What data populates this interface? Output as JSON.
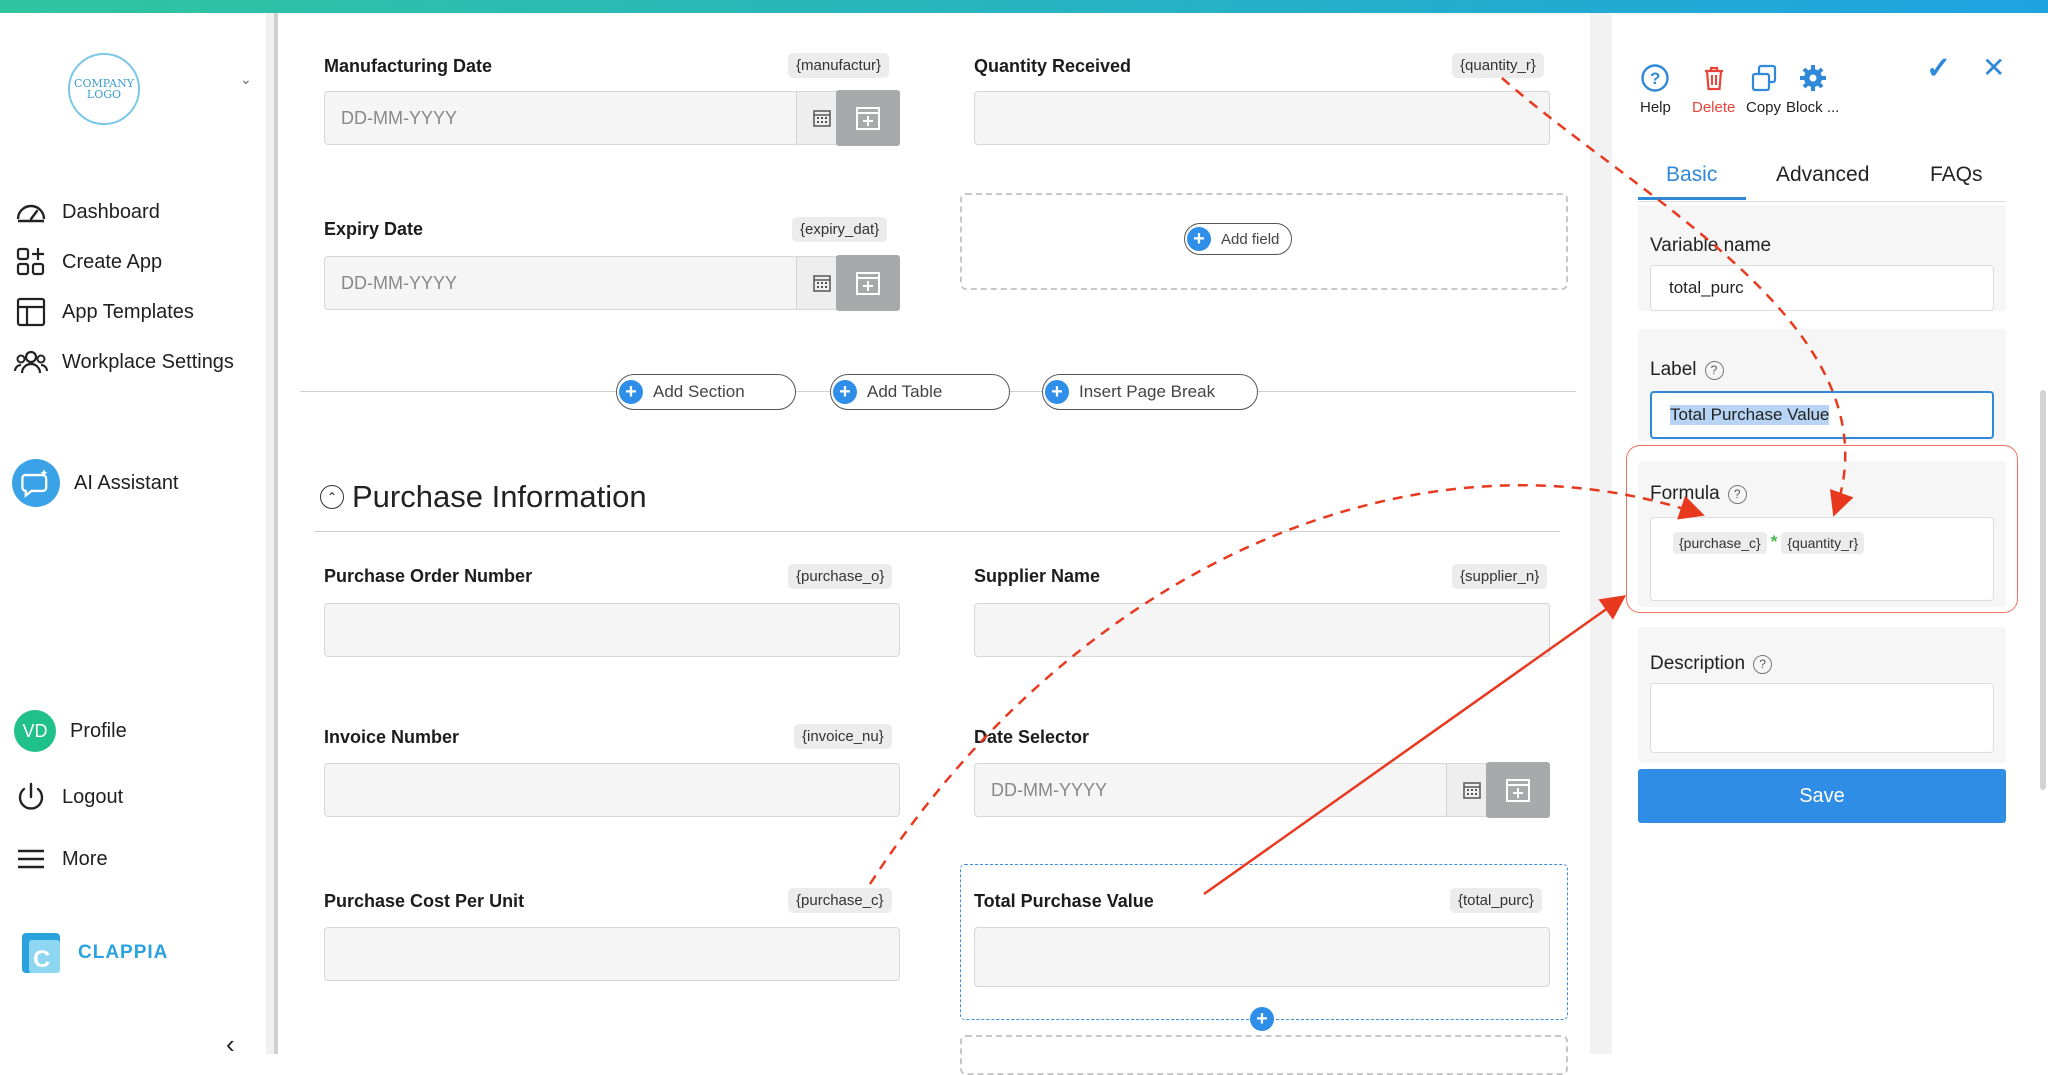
{
  "sidebar": {
    "logo_text": "COMPANY LOGO",
    "nav": [
      {
        "label": "Dashboard"
      },
      {
        "label": "Create App"
      },
      {
        "label": "App Templates"
      },
      {
        "label": "Workplace Settings"
      },
      {
        "label": "AI Assistant"
      }
    ],
    "profile": {
      "initials": "VD",
      "label": "Profile"
    },
    "logout_label": "Logout",
    "more_label": "More",
    "brand": "CLAPPIA"
  },
  "form": {
    "manufacturing": {
      "label": "Manufacturing Date",
      "var": "{manufactur}",
      "placeholder": "DD-MM-YYYY"
    },
    "quantity": {
      "label": "Quantity Received",
      "var": "{quantity_r}"
    },
    "expiry": {
      "label": "Expiry Date",
      "var": "{expiry_dat}",
      "placeholder": "DD-MM-YYYY"
    },
    "add_field_label": "Add field",
    "actions": {
      "add_section": "Add Section",
      "add_table": "Add Table",
      "insert_page_break": "Insert Page Break"
    },
    "section_title": "Purchase Information",
    "po_number": {
      "label": "Purchase Order Number",
      "var": "{purchase_o}"
    },
    "supplier": {
      "label": "Supplier Name",
      "var": "{supplier_n}"
    },
    "invoice": {
      "label": "Invoice Number",
      "var": "{invoice_nu}"
    },
    "date_selector": {
      "label": "Date Selector",
      "placeholder": "DD-MM-YYYY"
    },
    "cost_per_unit": {
      "label": "Purchase Cost Per Unit",
      "var": "{purchase_c}"
    },
    "total_value": {
      "label": "Total Purchase Value",
      "var": "{total_purc}"
    }
  },
  "panel": {
    "toolbar": {
      "help": "Help",
      "delete": "Delete",
      "copy": "Copy",
      "block": "Block ..."
    },
    "tabs": [
      "Basic",
      "Advanced",
      "FAQs"
    ],
    "active_tab": "Basic",
    "variable_name": {
      "label": "Variable name",
      "value": "total_purc"
    },
    "label_field": {
      "label": "Label",
      "value": "Total Purchase Value"
    },
    "formula": {
      "label": "Formula",
      "token1": "{purchase_c}",
      "operator": "*",
      "token2": "{quantity_r}"
    },
    "description": {
      "label": "Description",
      "value": ""
    },
    "save_label": "Save"
  },
  "colors": {
    "accent": "#2f8de6",
    "danger": "#e8443a",
    "highlight": "#f27060",
    "brand": "#2aa3dd"
  }
}
